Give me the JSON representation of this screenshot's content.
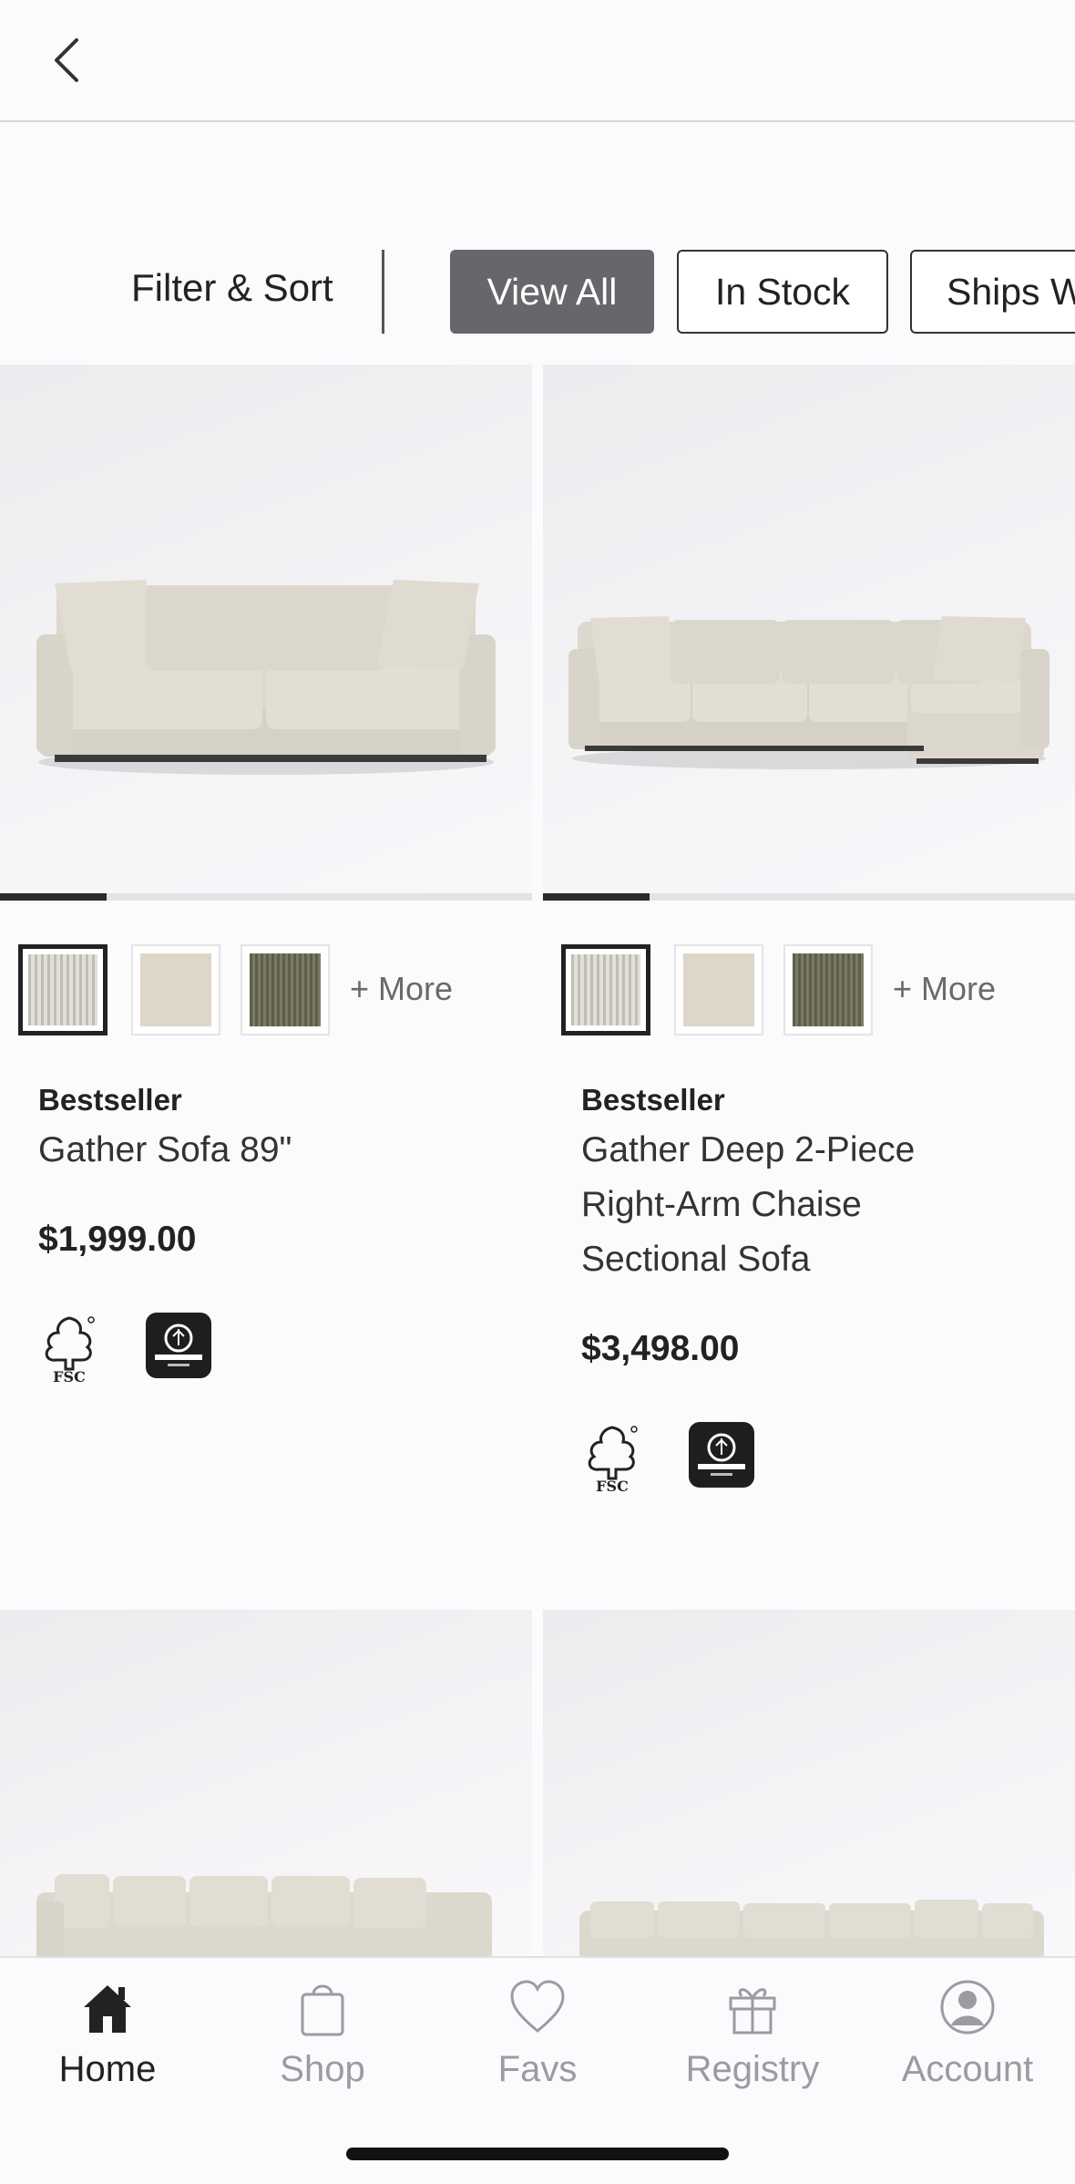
{
  "header": {
    "back_icon": "chevron-left-icon"
  },
  "filters": {
    "filter_sort_label": "Filter & Sort",
    "chips": [
      {
        "label": "View All",
        "active": true
      },
      {
        "label": "In Stock",
        "active": false
      },
      {
        "label": "Ships W",
        "active": false
      }
    ]
  },
  "products": [
    {
      "badge": "Bestseller",
      "name": "Gather Sofa 89\"",
      "price": "$1,999.00",
      "image_progress": 0.2,
      "swatches": [
        "white-weave",
        "cream",
        "olive"
      ],
      "more_label": "+ More",
      "certifications": [
        "fsc-logo",
        "greenguard-gold-logo"
      ]
    },
    {
      "badge": "Bestseller",
      "name": "Gather Deep 2-Piece Right-Arm Chaise Sectional Sofa",
      "price": "$3,498.00",
      "image_progress": 0.2,
      "swatches": [
        "white-weave",
        "cream",
        "olive"
      ],
      "more_label": "+ More",
      "certifications": [
        "fsc-logo",
        "greenguard-gold-logo"
      ]
    }
  ],
  "bottom_nav": [
    {
      "label": "Home",
      "icon": "home-icon",
      "active": true
    },
    {
      "label": "Shop",
      "icon": "shopping-bag-icon",
      "active": false
    },
    {
      "label": "Favs",
      "icon": "heart-icon",
      "active": false
    },
    {
      "label": "Registry",
      "icon": "gift-icon",
      "active": false
    },
    {
      "label": "Account",
      "icon": "account-icon",
      "active": false
    }
  ],
  "colors": {
    "accent_dark": "#222222",
    "chip_active_bg": "#67676b",
    "nav_inactive": "#9b9ba0"
  }
}
